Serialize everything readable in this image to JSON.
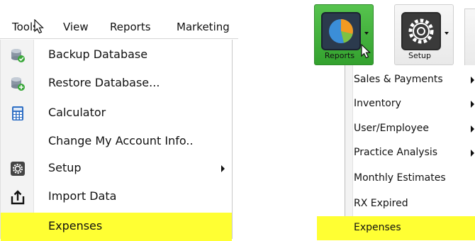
{
  "tools_menu": {
    "menubar": [
      "Tools",
      "View",
      "Reports",
      "Marketing"
    ],
    "items": [
      {
        "label": "Backup Database",
        "icon": "database-backup-icon",
        "submenu": false,
        "highlighted": false
      },
      {
        "label": "Restore Database...",
        "icon": "database-restore-icon",
        "submenu": false,
        "highlighted": false
      },
      {
        "label": "Calculator",
        "icon": "calculator-icon",
        "submenu": false,
        "highlighted": false
      },
      {
        "label": "Change My Account Info..",
        "icon": "",
        "submenu": false,
        "highlighted": false
      },
      {
        "label": "Setup",
        "icon": "gear-icon",
        "submenu": true,
        "highlighted": false
      },
      {
        "label": "Import Data",
        "icon": "import-icon",
        "submenu": false,
        "highlighted": false
      },
      {
        "label": "Expenses",
        "icon": "",
        "submenu": false,
        "highlighted": true
      }
    ]
  },
  "reports_ribbon": {
    "buttons": [
      {
        "label": "Reports",
        "icon": "pie-chart-icon",
        "active": true
      },
      {
        "label": "Setup",
        "icon": "gear-icon",
        "active": false
      }
    ],
    "items": [
      {
        "label": "Sales & Payments",
        "submenu": true,
        "highlighted": false
      },
      {
        "label": "Inventory",
        "submenu": true,
        "highlighted": false
      },
      {
        "label": "User/Employee",
        "submenu": true,
        "highlighted": false
      },
      {
        "label": "Practice Analysis",
        "submenu": true,
        "highlighted": false
      },
      {
        "label": "Monthly Estimates",
        "submenu": false,
        "highlighted": false
      },
      {
        "label": "RX Expired",
        "submenu": false,
        "highlighted": false
      },
      {
        "label": "Expenses",
        "submenu": false,
        "highlighted": true
      }
    ]
  },
  "colors": {
    "highlight": "#ffff33",
    "reports_button": "#3fae38",
    "text": "#111111"
  }
}
